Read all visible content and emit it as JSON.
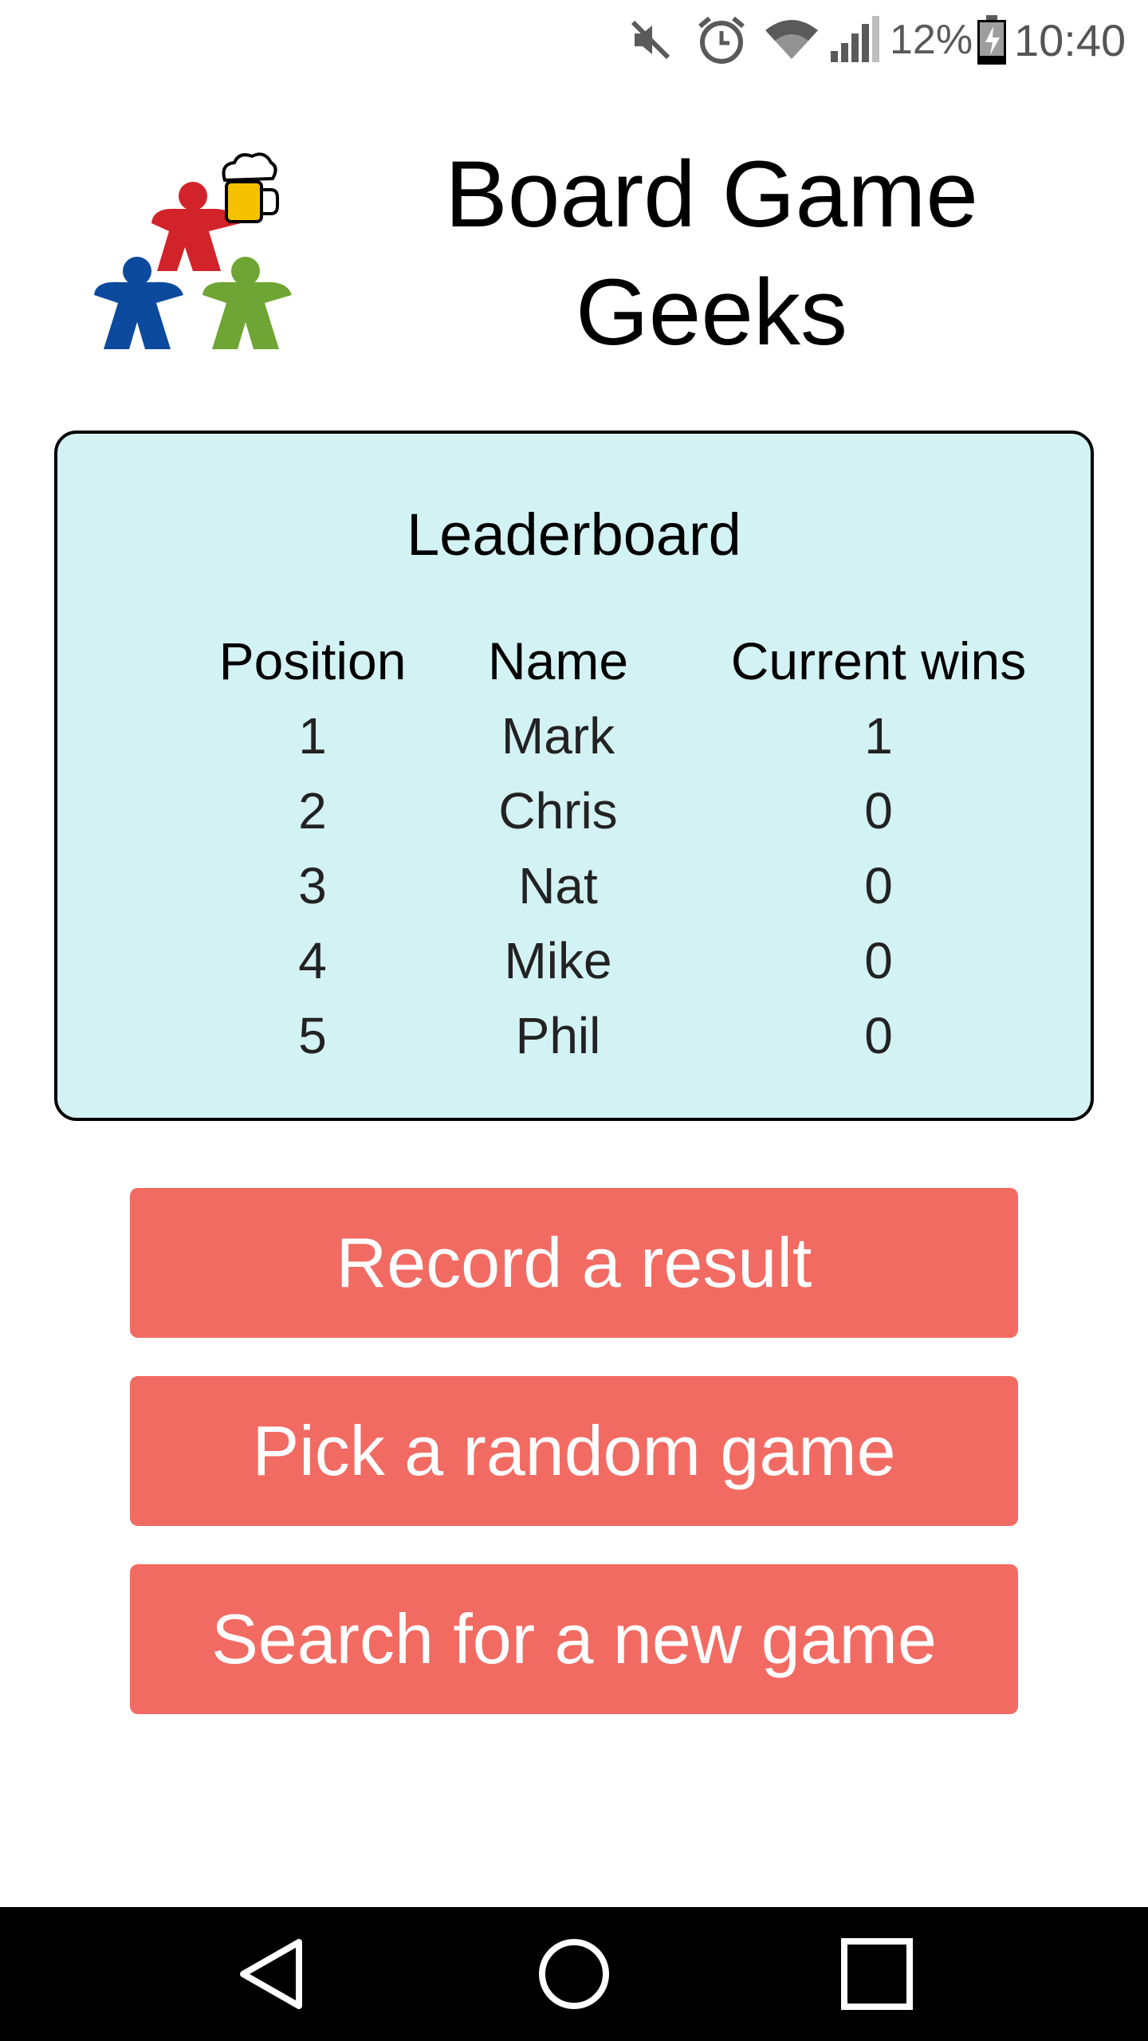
{
  "status_bar": {
    "icons": [
      "mute-icon",
      "alarm-icon",
      "wifi-icon",
      "signal-icon",
      "battery-charging-icon"
    ],
    "battery": "12%",
    "time": "10:40"
  },
  "header": {
    "logo": "meeple-beer-logo",
    "title": "Board Game Geeks"
  },
  "leaderboard": {
    "title": "Leaderboard",
    "columns": [
      "Position",
      "Name",
      "Current wins"
    ],
    "rows": [
      {
        "position": "1",
        "name": "Mark",
        "wins": "1"
      },
      {
        "position": "2",
        "name": "Chris",
        "wins": "0"
      },
      {
        "position": "3",
        "name": "Nat",
        "wins": "0"
      },
      {
        "position": "4",
        "name": "Mike",
        "wins": "0"
      },
      {
        "position": "5",
        "name": "Phil",
        "wins": "0"
      }
    ],
    "background": "#d3f2f3"
  },
  "actions": {
    "record": "Record a result",
    "random": "Pick a random game",
    "search": "Search for a new game",
    "color": "#f26b63"
  },
  "nav_bar": {
    "icons": [
      "back-icon",
      "home-icon",
      "recents-icon"
    ]
  }
}
